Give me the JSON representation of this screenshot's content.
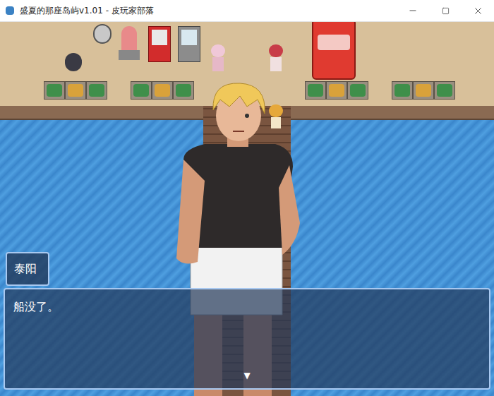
{
  "window": {
    "title": "盛夏的那座岛屿v1.01 - 皮玩家部落"
  },
  "dialog": {
    "speaker": "泰阳",
    "text": "船没了。",
    "continue_marker": "▼"
  }
}
